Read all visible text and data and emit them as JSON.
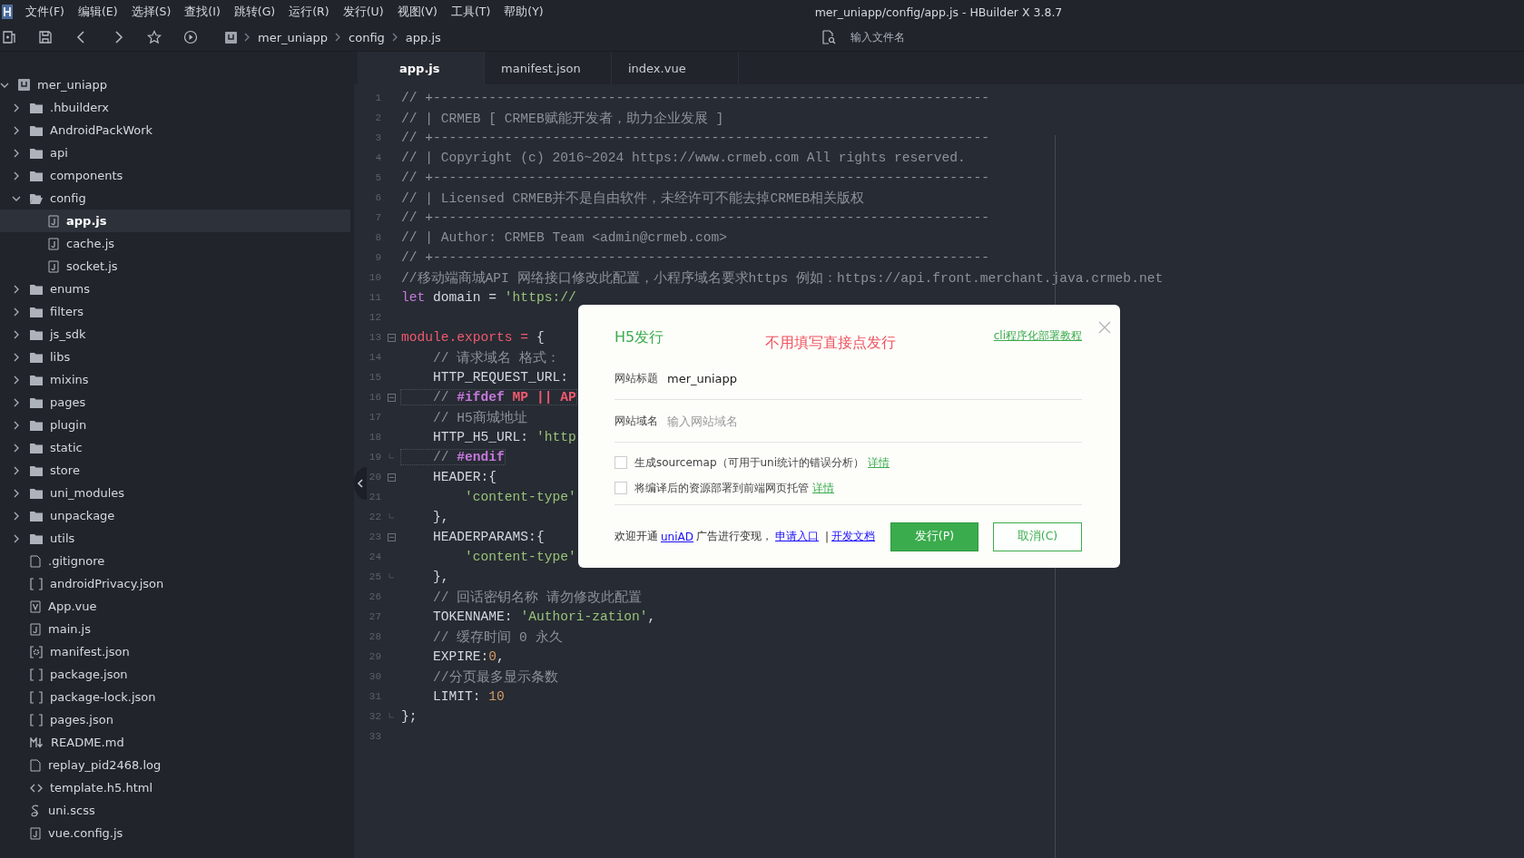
{
  "window": {
    "title": "mer_uniapp/config/app.js - HBuilder X 3.8.7"
  },
  "menu": [
    "文件(F)",
    "编辑(E)",
    "选择(S)",
    "查找(I)",
    "跳转(G)",
    "运行(R)",
    "发行(U)",
    "视图(V)",
    "工具(T)",
    "帮助(Y)"
  ],
  "breadcrumb": [
    "mer_uniapp",
    "config",
    "app.js"
  ],
  "file_search": {
    "placeholder": "输入文件名"
  },
  "tree": {
    "label": "mer_uniapp",
    "kind": "project",
    "expanded": true,
    "selected": false,
    "children": [
      {
        "label": ".hbuilderx",
        "kind": "folder",
        "expanded": false,
        "selected": false
      },
      {
        "label": "AndroidPackWork",
        "kind": "folder",
        "expanded": false,
        "selected": false
      },
      {
        "label": "api",
        "kind": "folder",
        "expanded": false,
        "selected": false
      },
      {
        "label": "components",
        "kind": "folder",
        "expanded": false,
        "selected": false
      },
      {
        "label": "config",
        "kind": "folder",
        "expanded": true,
        "selected": false,
        "children": [
          {
            "label": "app.js",
            "kind": "js",
            "selected": true
          },
          {
            "label": "cache.js",
            "kind": "js",
            "selected": false
          },
          {
            "label": "socket.js",
            "kind": "js",
            "selected": false
          }
        ]
      },
      {
        "label": "enums",
        "kind": "folder",
        "expanded": false,
        "selected": false
      },
      {
        "label": "filters",
        "kind": "folder",
        "expanded": false,
        "selected": false
      },
      {
        "label": "js_sdk",
        "kind": "folder",
        "expanded": false,
        "selected": false
      },
      {
        "label": "libs",
        "kind": "folder",
        "expanded": false,
        "selected": false
      },
      {
        "label": "mixins",
        "kind": "folder",
        "expanded": false,
        "selected": false
      },
      {
        "label": "pages",
        "kind": "folder",
        "expanded": false,
        "selected": false
      },
      {
        "label": "plugin",
        "kind": "folder",
        "expanded": false,
        "selected": false
      },
      {
        "label": "static",
        "kind": "folder",
        "expanded": false,
        "selected": false
      },
      {
        "label": "store",
        "kind": "folder",
        "expanded": false,
        "selected": false
      },
      {
        "label": "uni_modules",
        "kind": "folder",
        "expanded": false,
        "selected": false
      },
      {
        "label": "unpackage",
        "kind": "folder",
        "expanded": false,
        "selected": false
      },
      {
        "label": "utils",
        "kind": "folder",
        "expanded": false,
        "selected": false
      },
      {
        "label": ".gitignore",
        "kind": "file",
        "selected": false
      },
      {
        "label": "androidPrivacy.json",
        "kind": "json",
        "selected": false
      },
      {
        "label": "App.vue",
        "kind": "vue",
        "selected": false
      },
      {
        "label": "main.js",
        "kind": "js",
        "selected": false
      },
      {
        "label": "manifest.json",
        "kind": "manifest",
        "selected": false
      },
      {
        "label": "package.json",
        "kind": "json",
        "selected": false
      },
      {
        "label": "package-lock.json",
        "kind": "json",
        "selected": false
      },
      {
        "label": "pages.json",
        "kind": "json",
        "selected": false
      },
      {
        "label": "README.md",
        "kind": "md",
        "selected": false
      },
      {
        "label": "replay_pid2468.log",
        "kind": "file",
        "selected": false
      },
      {
        "label": "template.h5.html",
        "kind": "html",
        "selected": false
      },
      {
        "label": "uni.scss",
        "kind": "scss",
        "selected": false
      },
      {
        "label": "vue.config.js",
        "kind": "js",
        "selected": false
      }
    ]
  },
  "tabs": [
    {
      "label": "app.js",
      "selected": true
    },
    {
      "label": "manifest.json",
      "selected": false
    },
    {
      "label": "index.vue",
      "selected": false
    }
  ],
  "code": [
    {
      "n": "1",
      "fold_start": false,
      "fold_end": false,
      "boxed": false,
      "tokens": [
        {
          "kind": "comment",
          "text": "// +----------------------------------------------------------------------"
        }
      ]
    },
    {
      "n": "2",
      "fold_start": false,
      "fold_end": false,
      "boxed": false,
      "tokens": [
        {
          "kind": "comment",
          "text": "// | CRMEB [ CRMEB赋能开发者，助力企业发展 ]"
        }
      ]
    },
    {
      "n": "3",
      "fold_start": false,
      "fold_end": false,
      "boxed": false,
      "tokens": [
        {
          "kind": "comment",
          "text": "// +----------------------------------------------------------------------"
        }
      ]
    },
    {
      "n": "4",
      "fold_start": false,
      "fold_end": false,
      "boxed": false,
      "tokens": [
        {
          "kind": "comment",
          "text": "// | Copyright (c) 2016~2024 https://www.crmeb.com All rights reserved."
        }
      ]
    },
    {
      "n": "5",
      "fold_start": false,
      "fold_end": false,
      "boxed": false,
      "tokens": [
        {
          "kind": "comment",
          "text": "// +----------------------------------------------------------------------"
        }
      ]
    },
    {
      "n": "6",
      "fold_start": false,
      "fold_end": false,
      "boxed": false,
      "tokens": [
        {
          "kind": "comment",
          "text": "// | Licensed CRMEB并不是自由软件，未经许可不能去掉CRMEB相关版权"
        }
      ]
    },
    {
      "n": "7",
      "fold_start": false,
      "fold_end": false,
      "boxed": false,
      "tokens": [
        {
          "kind": "comment",
          "text": "// +----------------------------------------------------------------------"
        }
      ]
    },
    {
      "n": "8",
      "fold_start": false,
      "fold_end": false,
      "boxed": false,
      "tokens": [
        {
          "kind": "comment",
          "text": "// | Author: CRMEB Team <admin@crmeb.com>"
        }
      ]
    },
    {
      "n": "9",
      "fold_start": false,
      "fold_end": false,
      "boxed": false,
      "tokens": [
        {
          "kind": "comment",
          "text": "// +----------------------------------------------------------------------"
        }
      ]
    },
    {
      "n": "10",
      "fold_start": false,
      "fold_end": false,
      "boxed": false,
      "tokens": [
        {
          "kind": "comment",
          "text": "//移动端商城API 网络接口修改此配置，小程序域名要求https 例如：https://api.front.merchant.java.crmeb.net"
        }
      ]
    },
    {
      "n": "11",
      "fold_start": false,
      "fold_end": false,
      "boxed": false,
      "tokens": [
        {
          "kind": "keyword",
          "text": "let"
        },
        {
          "kind": "plain",
          "text": " domain = "
        },
        {
          "kind": "string",
          "text": "'https://"
        }
      ]
    },
    {
      "n": "12",
      "fold_start": false,
      "fold_end": false,
      "boxed": false
    },
    {
      "n": "13",
      "fold_start": true,
      "fold_end": false,
      "boxed": false,
      "tokens": [
        {
          "kind": "ident",
          "text": "module.exports = "
        },
        {
          "kind": "plain",
          "text": "{"
        }
      ]
    },
    {
      "n": "14",
      "fold_start": false,
      "fold_end": false,
      "boxed": false,
      "tokens": [
        {
          "kind": "comment",
          "text": "    // 请求域名 格式："
        }
      ]
    },
    {
      "n": "15",
      "fold_start": false,
      "fold_end": false,
      "boxed": false,
      "tokens": [
        {
          "kind": "plain",
          "text": "    HTTP_REQUEST_URL:"
        }
      ]
    },
    {
      "n": "16",
      "fold_start": true,
      "fold_end": false,
      "boxed": true,
      "tokens": [
        {
          "kind": "comment",
          "text": "    // "
        },
        {
          "kind": "macro",
          "text": "#ifdef"
        },
        {
          "kind": "directive",
          "text": " MP || AP"
        }
      ]
    },
    {
      "n": "17",
      "fold_start": false,
      "fold_end": false,
      "boxed": false,
      "tokens": [
        {
          "kind": "comment",
          "text": "    // H5商城地址"
        }
      ]
    },
    {
      "n": "18",
      "fold_start": false,
      "fold_end": false,
      "boxed": false,
      "tokens": [
        {
          "kind": "plain",
          "text": "    HTTP_H5_URL: "
        },
        {
          "kind": "string",
          "text": "'http"
        }
      ]
    },
    {
      "n": "19",
      "fold_start": false,
      "fold_end": true,
      "boxed": true,
      "tokens": [
        {
          "kind": "comment",
          "text": "    // "
        },
        {
          "kind": "macro",
          "text": "#endif"
        }
      ]
    },
    {
      "n": "20",
      "fold_start": true,
      "fold_end": false,
      "boxed": false,
      "tokens": [
        {
          "kind": "plain",
          "text": "    HEADER:{"
        }
      ]
    },
    {
      "n": "21",
      "fold_start": false,
      "fold_end": false,
      "boxed": false,
      "tokens": [
        {
          "kind": "string",
          "text": "        'content-type'"
        }
      ]
    },
    {
      "n": "22",
      "fold_start": false,
      "fold_end": true,
      "boxed": false,
      "tokens": [
        {
          "kind": "plain",
          "text": "    },"
        }
      ]
    },
    {
      "n": "23",
      "fold_start": true,
      "fold_end": false,
      "boxed": false,
      "tokens": [
        {
          "kind": "plain",
          "text": "    HEADERPARAMS:{"
        }
      ]
    },
    {
      "n": "24",
      "fold_start": false,
      "fold_end": false,
      "boxed": false,
      "tokens": [
        {
          "kind": "string",
          "text": "        'content-type'"
        }
      ]
    },
    {
      "n": "25",
      "fold_start": false,
      "fold_end": true,
      "boxed": false,
      "tokens": [
        {
          "kind": "plain",
          "text": "    },"
        }
      ]
    },
    {
      "n": "26",
      "fold_start": false,
      "fold_end": false,
      "boxed": false,
      "tokens": [
        {
          "kind": "comment",
          "text": "    // 回话密钥名称 请勿修改此配置"
        }
      ]
    },
    {
      "n": "27",
      "fold_start": false,
      "fold_end": false,
      "boxed": false,
      "tokens": [
        {
          "kind": "plain",
          "text": "    TOKENNAME: "
        },
        {
          "kind": "string",
          "text": "'Authori-zation'"
        },
        {
          "kind": "plain",
          "text": ","
        }
      ]
    },
    {
      "n": "28",
      "fold_start": false,
      "fold_end": false,
      "boxed": false,
      "tokens": [
        {
          "kind": "comment",
          "text": "    // 缓存时间 0 永久"
        }
      ]
    },
    {
      "n": "29",
      "fold_start": false,
      "fold_end": false,
      "boxed": false,
      "tokens": [
        {
          "kind": "plain",
          "text": "    EXPIRE:"
        },
        {
          "kind": "number",
          "text": "0"
        },
        {
          "kind": "plain",
          "text": ","
        }
      ]
    },
    {
      "n": "30",
      "fold_start": false,
      "fold_end": false,
      "boxed": false,
      "tokens": [
        {
          "kind": "comment",
          "text": "    //分页最多显示条数"
        }
      ]
    },
    {
      "n": "31",
      "fold_start": false,
      "fold_end": false,
      "boxed": false,
      "tokens": [
        {
          "kind": "plain",
          "text": "    LIMIT: "
        },
        {
          "kind": "number",
          "text": "10"
        }
      ]
    },
    {
      "n": "32",
      "fold_start": false,
      "fold_end": true,
      "boxed": false,
      "tokens": [
        {
          "kind": "plain",
          "text": "};"
        }
      ]
    },
    {
      "n": "33",
      "fold_start": false,
      "fold_end": false,
      "boxed": false
    }
  ],
  "dialog": {
    "title": "H5发行",
    "hint": "不用填写直接点发行",
    "link": "cli程序化部署教程",
    "fields": [
      {
        "label": "网站标题",
        "value": "mer_uniapp"
      },
      {
        "label": "网站域名",
        "placeholder": "输入网站域名"
      }
    ],
    "options": [
      {
        "label": "生成sourcemap（可用于uni统计的错误分析）",
        "link": "详情",
        "checked": false
      },
      {
        "label": "将编译后的资源部署到前端网页托管",
        "link": "详情",
        "checked": false
      }
    ],
    "footer": {
      "text_1": "欢迎开通",
      "link_1": "uniAD",
      "text_2": "广告进行变现，",
      "link_2": "申请入口",
      "separator": "|",
      "link_3": "开发文档"
    },
    "buttons": [
      {
        "label": "发行(P)",
        "kind": "primary"
      },
      {
        "label": "取消(C)",
        "kind": "secondary"
      }
    ]
  }
}
